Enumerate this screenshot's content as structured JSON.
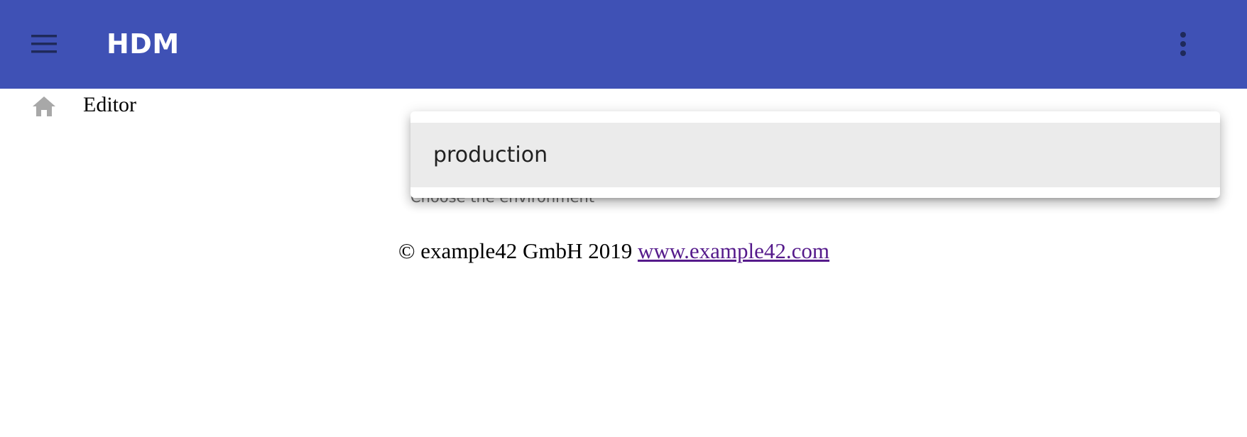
{
  "app_bar": {
    "title": "HDM",
    "menu_icon": "hamburger-menu-icon",
    "more_icon": "more-vert-icon",
    "background_color": "#3f51b5"
  },
  "nav": {
    "home_icon": "home-icon",
    "editor_label": "Editor"
  },
  "environment_select": {
    "helper_text": "Choose the environment",
    "options": [
      "production"
    ],
    "highlighted_option": "production"
  },
  "footer": {
    "copyright": "© example42 GmbH 2019",
    "link_text": "www.example42.com"
  }
}
